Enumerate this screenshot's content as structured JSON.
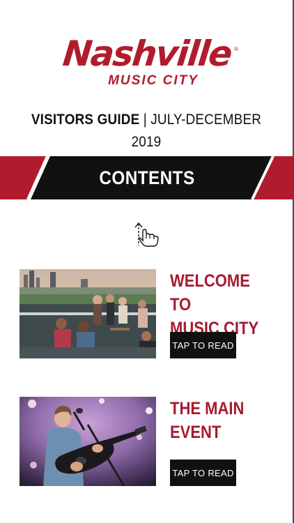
{
  "logo": {
    "wordmark": "Nashville",
    "tagline": "MUSIC CITY",
    "registered": "®"
  },
  "header": {
    "title_bold": "VISITORS GUIDE",
    "separator": "|",
    "edition": "JULY-DECEMBER 2019"
  },
  "banner": {
    "label": "CONTENTS"
  },
  "hint": {
    "icon": "swipe-up-icon"
  },
  "articles": [
    {
      "title_line1": "WELCOME TO",
      "title_line2": "MUSIC CITY",
      "button_label": "TAP TO READ",
      "image": "rooftop-party-photo"
    },
    {
      "title_line1": "THE MAIN",
      "title_line2": "EVENT",
      "button_label": "TAP TO READ",
      "image": "guitarist-performance-photo"
    }
  ],
  "colors": {
    "brand_red": "#b01c2e",
    "headline_red": "#a51b31",
    "banner_black": "#111111",
    "background": "#ffffff"
  }
}
